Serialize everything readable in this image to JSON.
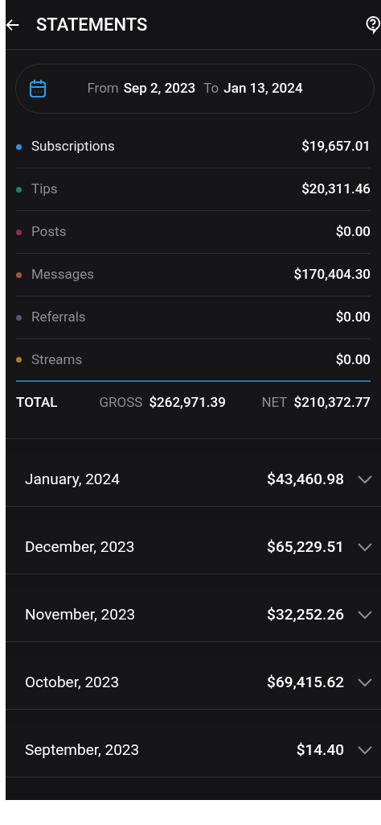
{
  "header": {
    "title": "STATEMENTS"
  },
  "date_range": {
    "from_label": "From",
    "from": "Sep 2, 2023",
    "to_label": "To",
    "to": "Jan 13, 2024"
  },
  "categories": [
    {
      "name": "Subscriptions",
      "amount": "$19,657.01",
      "color": "#2f8fe0",
      "selected": true
    },
    {
      "name": "Tips",
      "amount": "$20,311.46",
      "color": "#1f7f7a",
      "selected": false
    },
    {
      "name": "Posts",
      "amount": "$0.00",
      "color": "#8a2f4e",
      "selected": false
    },
    {
      "name": "Messages",
      "amount": "$170,404.30",
      "color": "#a8553a",
      "selected": false
    },
    {
      "name": "Referrals",
      "amount": "$0.00",
      "color": "#5a4f80",
      "selected": false
    },
    {
      "name": "Streams",
      "amount": "$0.00",
      "color": "#b07a20",
      "selected": false
    }
  ],
  "total": {
    "label": "TOTAL",
    "gross_label": "GROSS",
    "gross": "$262,971.39",
    "net_label": "NET",
    "net": "$210,372.77"
  },
  "months": [
    {
      "label": "January, 2024",
      "amount": "$43,460.98",
      "expanded": false
    },
    {
      "label": "December, 2023",
      "amount": "$65,229.51",
      "expanded": false
    },
    {
      "label": "November, 2023",
      "amount": "$32,252.26",
      "expanded": false
    },
    {
      "label": "October, 2023",
      "amount": "$69,415.62",
      "expanded": false
    },
    {
      "label": "September, 2023",
      "amount": "$14.40",
      "expanded": false
    }
  ]
}
